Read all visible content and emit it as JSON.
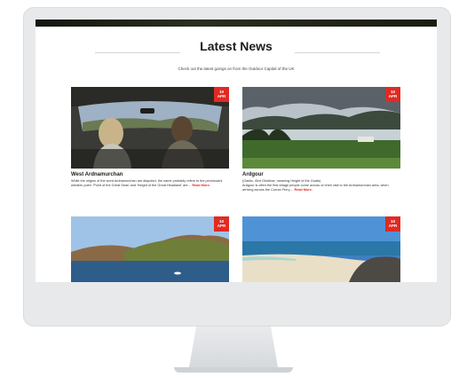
{
  "section": {
    "title": "Latest News",
    "subtitle": "Check out the latest goings on from the Outdoor Capital of the UK"
  },
  "cards": [
    {
      "day": "10",
      "month": "APR",
      "title": "West Ardnamurchan",
      "excerpt": "While the origins of the word Ardnamurchan are disputed, the name probably refers to the peninsula's western point: 'Point of the Great Seas' and 'Height of the Great Headland' are…",
      "read_more": "Read More."
    },
    {
      "day": "10",
      "month": "APR",
      "title": "Ardgour",
      "excerpt_line1": "(Gaelic: Àird Ghobhar, meaning Height of the Goats)",
      "excerpt": "Ardgour is often the first village people come across on their visit to the Ardnamurchan area, when arriving across the Corran Ferry…",
      "read_more": "Read More."
    },
    {
      "day": "10",
      "month": "APR"
    },
    {
      "day": "10",
      "month": "APR"
    }
  ],
  "colors": {
    "accent": "#e02a23",
    "monitor": "#e7e9eb"
  }
}
